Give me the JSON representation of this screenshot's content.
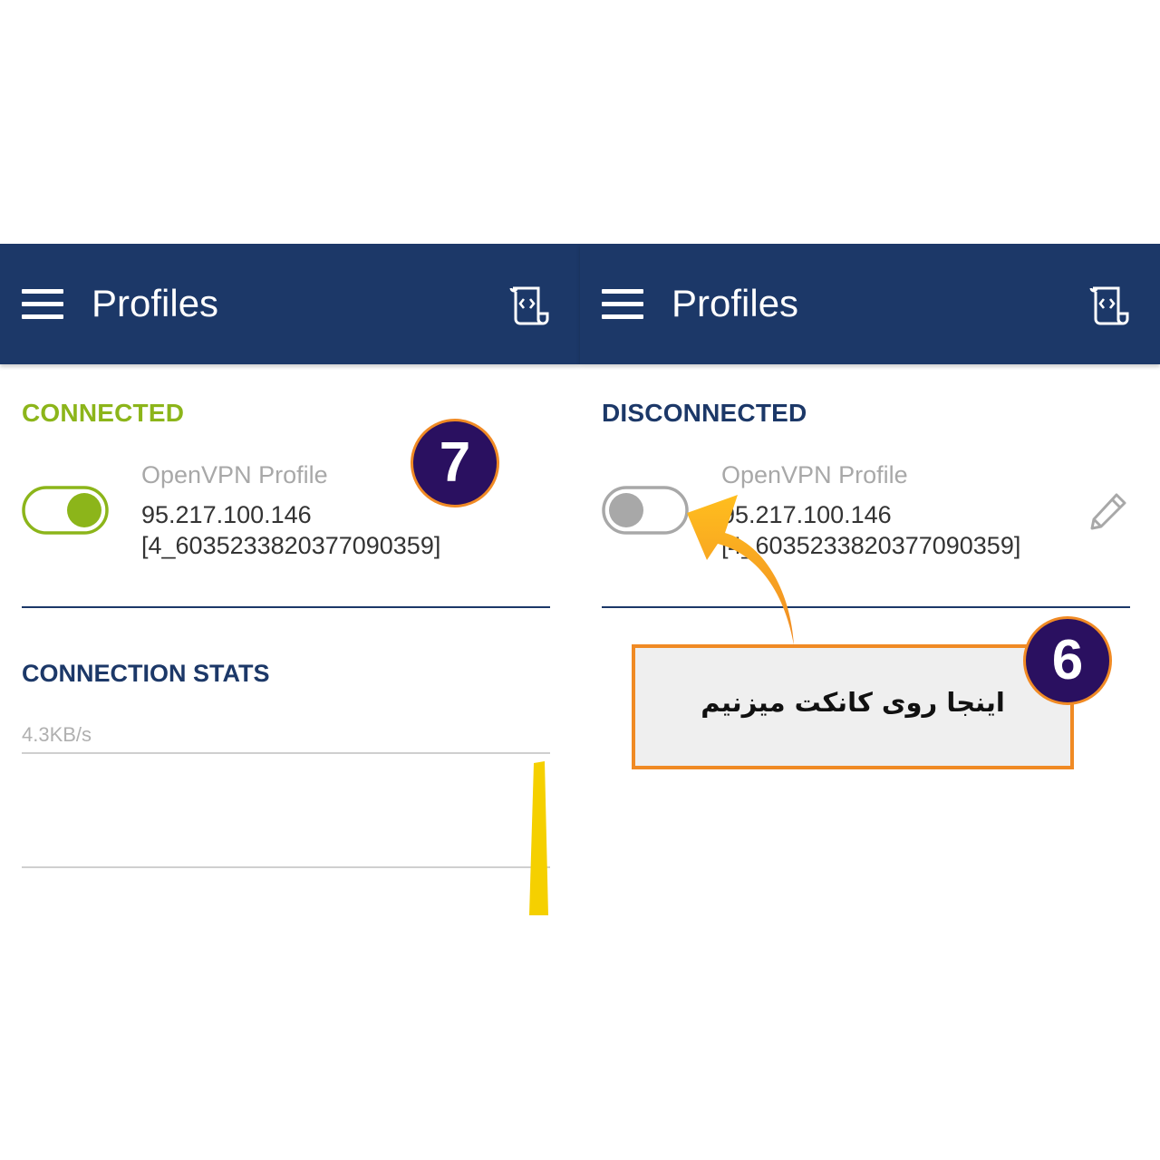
{
  "left_panel": {
    "appbar": {
      "title": "Profiles",
      "menu_icon": "hamburger-menu-icon",
      "import_icon": "import-file-icon"
    },
    "status_label": "CONNECTED",
    "profile": {
      "name": "OpenVPN Profile",
      "host": "95.217.100.146",
      "id": "[4_6035233820377090359]",
      "toggle_on": true
    },
    "stats": {
      "title": "CONNECTION STATS",
      "speed": "4.3KB/s"
    },
    "step_badge": "7"
  },
  "right_panel": {
    "appbar": {
      "title": "Profiles",
      "menu_icon": "hamburger-menu-icon",
      "import_icon": "import-file-icon"
    },
    "status_label": "DISCONNECTED",
    "profile": {
      "name": "OpenVPN Profile",
      "host": "95.217.100.146",
      "id": "[4_6035233820377090359]",
      "toggle_on": false,
      "edit_icon": "pencil-icon"
    },
    "step_badge": "6",
    "callout_text": "اینجا روی کانکت میزنیم"
  },
  "colors": {
    "appbar": "#1c3868",
    "connected": "#8cb51a",
    "disconnected": "#1c3868",
    "annotation_orange": "#f08a24",
    "badge": "#2a1060",
    "graph_spike": "#f5d000"
  }
}
